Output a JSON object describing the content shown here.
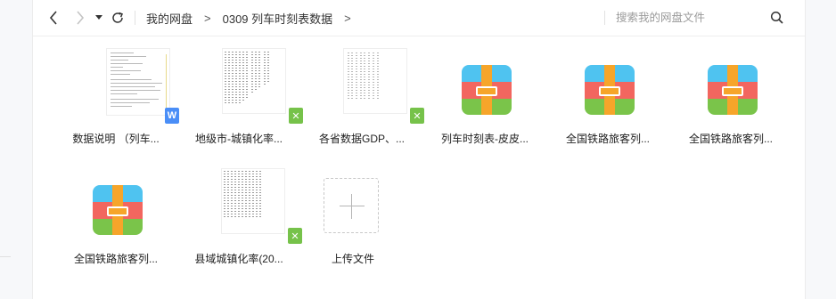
{
  "toolbar": {
    "breadcrumb": [
      "我的网盘",
      "0309 列车时刻表数据"
    ],
    "breadcrumb_separator": ">",
    "search_placeholder": "搜索我的网盘文件"
  },
  "files": [
    {
      "name": "数据说明 （列车...",
      "type": "word-doc",
      "badge": "W"
    },
    {
      "name": "地级市-城镇化率...",
      "type": "excel-sheet",
      "badge": "✕"
    },
    {
      "name": "各省数据GDP、...",
      "type": "excel-sheet",
      "badge": "✕"
    },
    {
      "name": "列车时刻表-皮皮...",
      "type": "archive"
    },
    {
      "name": "全国铁路旅客列...",
      "type": "archive"
    },
    {
      "name": "全国铁路旅客列...",
      "type": "archive"
    },
    {
      "name": "全国铁路旅客列...",
      "type": "archive"
    },
    {
      "name": "县域城镇化率(20...",
      "type": "excel-sheet",
      "badge": "✕"
    }
  ],
  "upload": {
    "label": "上传文件"
  },
  "colors": {
    "word_badge": "#4a8ef7",
    "excel_badge": "#76c24a",
    "archive_top": "#4fc3f0",
    "archive_middle": "#f2665f",
    "archive_bottom": "#7ac44a",
    "archive_strap": "#f6a52a"
  }
}
